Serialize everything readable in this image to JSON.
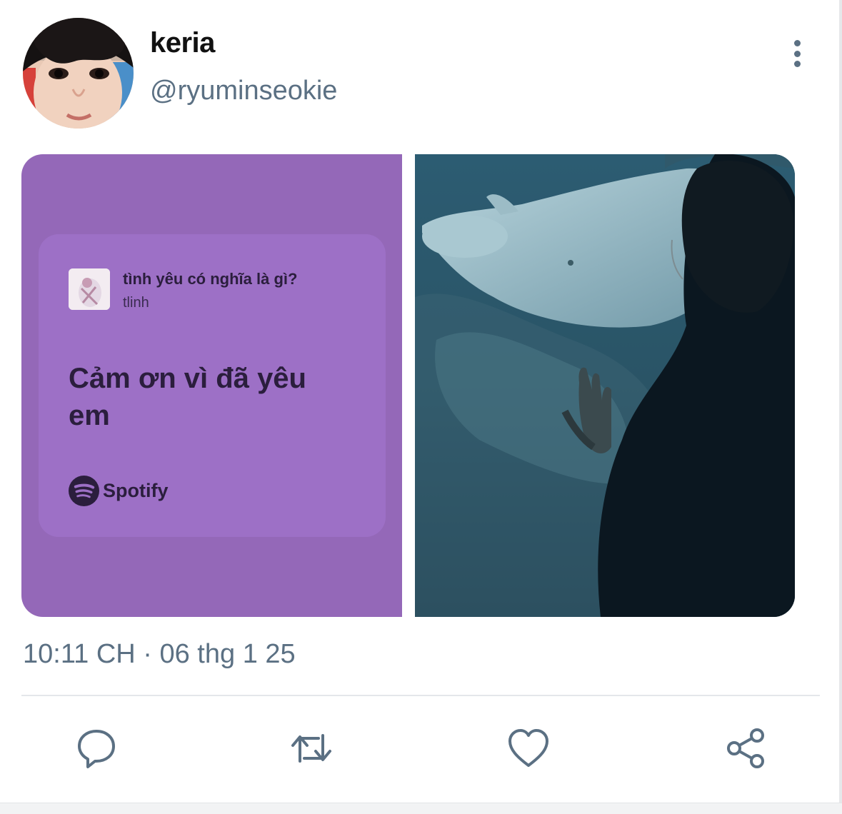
{
  "tweet": {
    "author": {
      "display_name": "keria",
      "handle": "@ryuminseokie",
      "avatar": "avatar-photo"
    },
    "more_icon": "more-vertical-icon",
    "media": {
      "left": {
        "type": "spotify-lyrics-card",
        "song_title": "tình yêu có nghĩa là gì?",
        "artist": "tlinh",
        "lyric": "Cảm ơn vì đã yêu em",
        "brand": "Spotify",
        "card_color": "#9d70c6",
        "background_color": "#9468b8"
      },
      "right": {
        "type": "photo",
        "subject": "person-at-aquarium-with-beluga"
      }
    },
    "timestamp": "10:11 CH · 06 thg 1 25",
    "actions": [
      {
        "name": "reply",
        "icon": "reply-icon"
      },
      {
        "name": "retweet",
        "icon": "retweet-icon"
      },
      {
        "name": "like",
        "icon": "heart-icon"
      },
      {
        "name": "share",
        "icon": "share-icon"
      }
    ],
    "colors": {
      "secondary_text": "#5b7083",
      "icon": "#5b7083",
      "divider": "#e4e7ea"
    }
  }
}
